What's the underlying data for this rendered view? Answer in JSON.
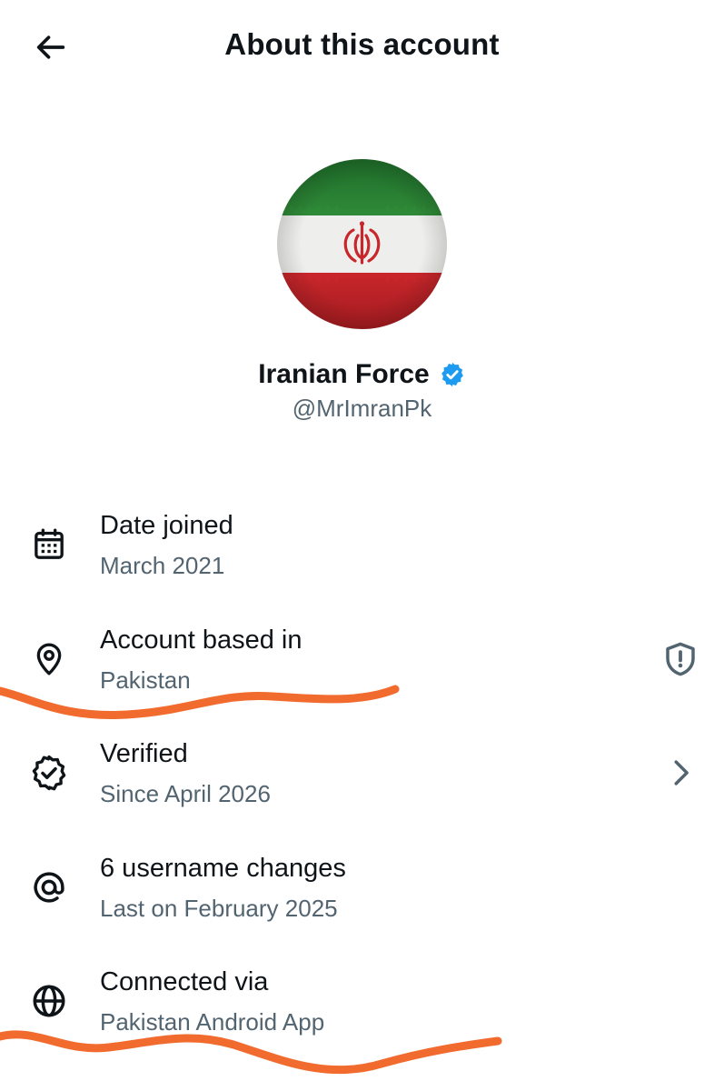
{
  "header": {
    "title": "About this account",
    "back_icon": "arrow-left-icon"
  },
  "profile": {
    "display_name": "Iranian Force",
    "handle": "@MrImranPk",
    "verified": true,
    "verified_badge_color": "#1d9bf0",
    "avatar_desc_icon": "iran-flag-avatar"
  },
  "rows": [
    {
      "title": "Date joined",
      "subtitle": "March 2021",
      "icon": "calendar-icon"
    },
    {
      "title": "Account based in",
      "subtitle": "Pakistan",
      "icon": "location-pin-icon",
      "right_icon": "shield-alert-icon"
    },
    {
      "title": "Verified",
      "subtitle": "Since April 2026",
      "icon": "verified-badge-icon",
      "right_icon": "chevron-right-icon"
    },
    {
      "title": "6 username changes",
      "subtitle": "Last on February 2025",
      "icon": "at-sign-icon"
    },
    {
      "title": "Connected via",
      "subtitle": "Pakistan Android App",
      "icon": "globe-icon"
    }
  ],
  "colors": {
    "text_primary": "#0f1419",
    "text_secondary": "#536471",
    "annotation": "#f26b2e"
  }
}
